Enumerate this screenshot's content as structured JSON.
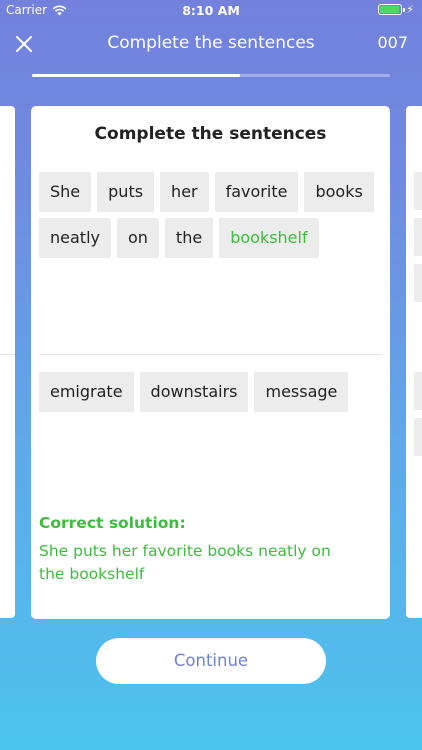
{
  "status_bar": {
    "carrier": "Carrier",
    "time": "8:10 AM",
    "battery_level": 0.92,
    "icons": [
      "wifi-icon",
      "battery-icon",
      "charging-icon"
    ]
  },
  "header": {
    "title": "Complete the sentences",
    "counter": "007",
    "close_icon": "close-icon"
  },
  "progress": {
    "fraction": 0.58
  },
  "card": {
    "title": "Complete the sentences",
    "answer_words": [
      {
        "text": "She",
        "state": "default"
      },
      {
        "text": "puts",
        "state": "default"
      },
      {
        "text": "her",
        "state": "default"
      },
      {
        "text": "favorite",
        "state": "default"
      },
      {
        "text": "books",
        "state": "default"
      },
      {
        "text": "neatly",
        "state": "default"
      },
      {
        "text": "on",
        "state": "default"
      },
      {
        "text": "the",
        "state": "default"
      },
      {
        "text": "bookshelf",
        "state": "correct"
      }
    ],
    "word_bank": [
      "emigrate",
      "downstairs",
      "message"
    ],
    "solution_label": "Correct solution:",
    "solution_text": "She puts her favorite books neatly on the bookshelf"
  },
  "continue_label": "Continue",
  "colors": {
    "correct": "#3dbd3d",
    "accent": "#6e82d3",
    "chip_bg": "#ececec"
  }
}
